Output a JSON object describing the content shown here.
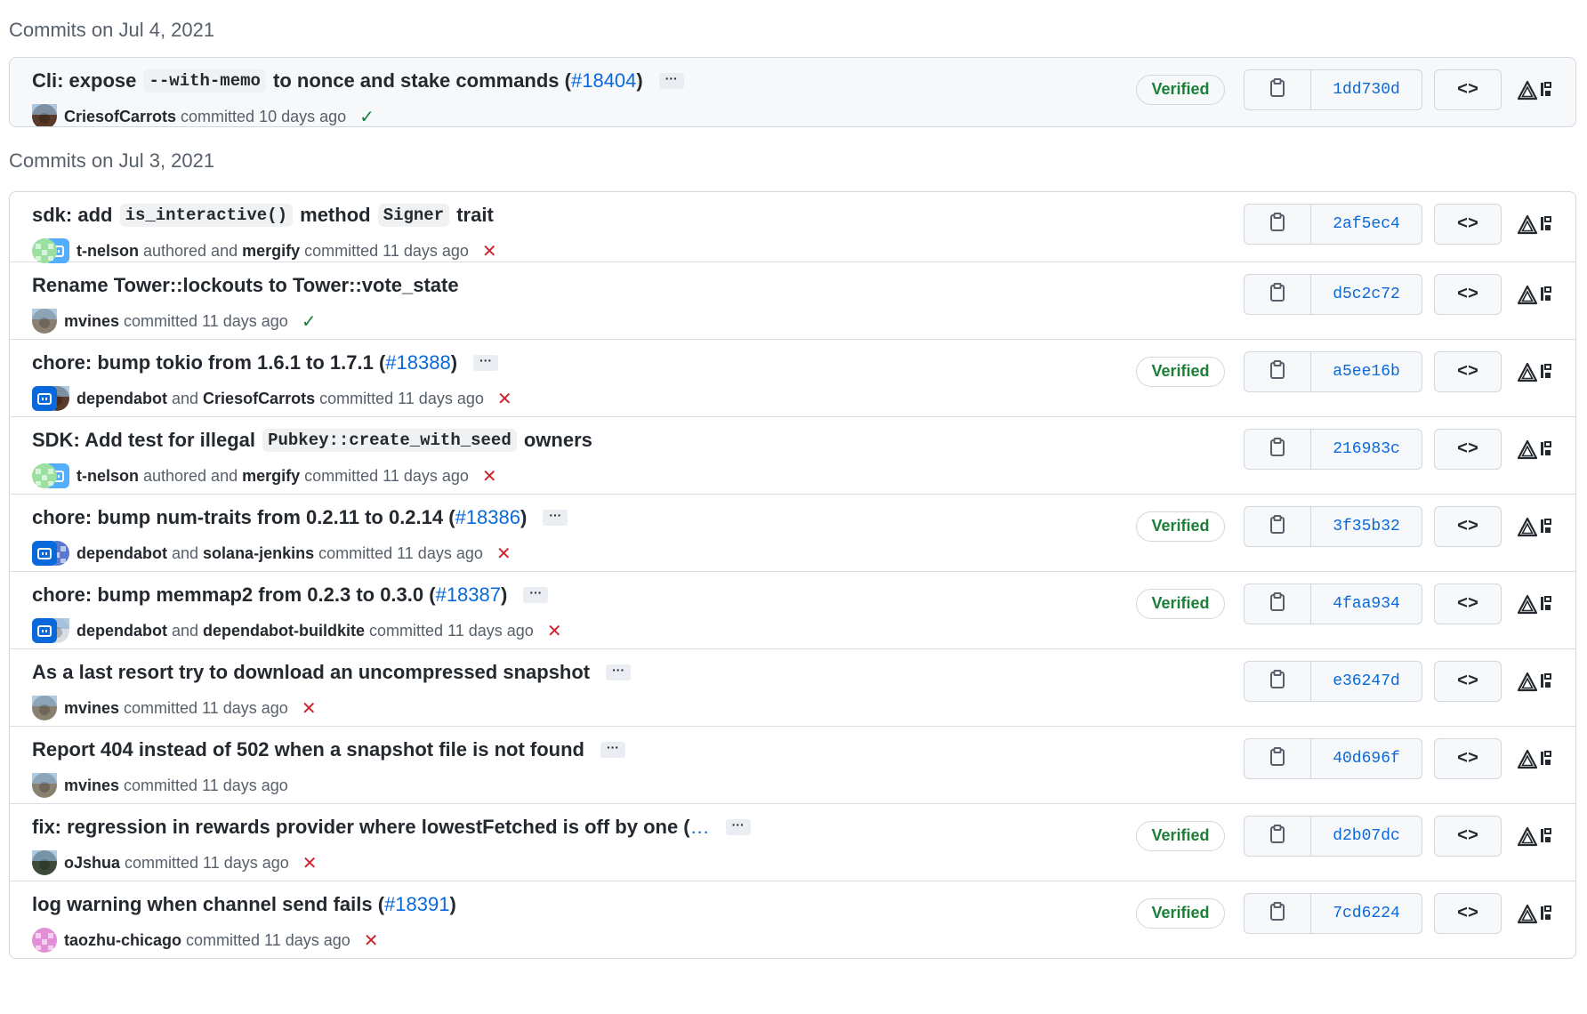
{
  "groups": [
    {
      "heading": "Commits on Jul 4, 2021",
      "highlight": true,
      "commits": [
        {
          "title_parts": [
            {
              "t": "text",
              "v": "Cli: expose "
            },
            {
              "t": "code",
              "v": "--with-memo"
            },
            {
              "t": "text",
              "v": " to nonce and stake commands ("
            },
            {
              "t": "link",
              "v": "#18404"
            },
            {
              "t": "text",
              "v": ")"
            }
          ],
          "has_ellipsis": true,
          "avatars": [
            {
              "kind": "photo",
              "color": "#5a3a2a",
              "name": "criesofcarrots-avatar"
            }
          ],
          "meta_parts": [
            {
              "t": "user",
              "v": "CriesofCarrots"
            },
            {
              "t": "word",
              "v": "committed 10 days ago"
            }
          ],
          "status": "ok",
          "status_glyph": "✓",
          "verified": "Verified",
          "sha": "1dd730d",
          "browse": "<>"
        }
      ]
    },
    {
      "heading": "Commits on Jul 3, 2021",
      "highlight": false,
      "commits": [
        {
          "title_parts": [
            {
              "t": "text",
              "v": "sdk: add "
            },
            {
              "t": "code",
              "v": "is_interactive()"
            },
            {
              "t": "text",
              "v": " method "
            },
            {
              "t": "code",
              "v": "Signer"
            },
            {
              "t": "text",
              "v": " trait"
            }
          ],
          "has_ellipsis": false,
          "avatars": [
            {
              "kind": "pixel",
              "color": "#9be0a0",
              "name": "t-nelson-avatar"
            },
            {
              "kind": "bot",
              "color": "#54aeff",
              "name": "mergify-avatar"
            }
          ],
          "meta_parts": [
            {
              "t": "user",
              "v": "t-nelson"
            },
            {
              "t": "word",
              "v": "authored and"
            },
            {
              "t": "user",
              "v": "mergify"
            },
            {
              "t": "word",
              "v": "committed 11 days ago"
            }
          ],
          "status": "fail",
          "status_glyph": "✕",
          "verified": "",
          "sha": "2af5ec4",
          "browse": "<>"
        },
        {
          "title_parts": [
            {
              "t": "text",
              "v": "Rename Tower::lockouts to Tower::vote_state"
            }
          ],
          "has_ellipsis": false,
          "avatars": [
            {
              "kind": "photo",
              "color": "#8a8070",
              "name": "mvines-avatar"
            }
          ],
          "meta_parts": [
            {
              "t": "user",
              "v": "mvines"
            },
            {
              "t": "word",
              "v": "committed 11 days ago"
            }
          ],
          "status": "ok",
          "status_glyph": "✓",
          "verified": "",
          "sha": "d5c2c72",
          "browse": "<>"
        },
        {
          "title_parts": [
            {
              "t": "text",
              "v": "chore: bump tokio from 1.6.1 to 1.7.1 ("
            },
            {
              "t": "link",
              "v": "#18388"
            },
            {
              "t": "text",
              "v": ")"
            }
          ],
          "has_ellipsis": true,
          "avatars": [
            {
              "kind": "bot",
              "color": "#0969da",
              "name": "dependabot-avatar"
            },
            {
              "kind": "photo",
              "color": "#5a3a2a",
              "name": "criesofcarrots-avatar"
            }
          ],
          "meta_parts": [
            {
              "t": "user",
              "v": "dependabot"
            },
            {
              "t": "word",
              "v": "and"
            },
            {
              "t": "user",
              "v": "CriesofCarrots"
            },
            {
              "t": "word",
              "v": "committed 11 days ago"
            }
          ],
          "status": "fail",
          "status_glyph": "✕",
          "verified": "Verified",
          "sha": "a5ee16b",
          "browse": "<>"
        },
        {
          "title_parts": [
            {
              "t": "text",
              "v": "SDK: Add test for illegal "
            },
            {
              "t": "code",
              "v": "Pubkey::create_with_seed"
            },
            {
              "t": "text",
              "v": " owners"
            }
          ],
          "has_ellipsis": false,
          "avatars": [
            {
              "kind": "pixel",
              "color": "#9be0a0",
              "name": "t-nelson-avatar"
            },
            {
              "kind": "bot",
              "color": "#54aeff",
              "name": "mergify-avatar"
            }
          ],
          "meta_parts": [
            {
              "t": "user",
              "v": "t-nelson"
            },
            {
              "t": "word",
              "v": "authored and"
            },
            {
              "t": "user",
              "v": "mergify"
            },
            {
              "t": "word",
              "v": "committed 11 days ago"
            }
          ],
          "status": "fail",
          "status_glyph": "✕",
          "verified": "",
          "sha": "216983c",
          "browse": "<>"
        },
        {
          "title_parts": [
            {
              "t": "text",
              "v": "chore: bump num-traits from 0.2.11 to 0.2.14 ("
            },
            {
              "t": "link",
              "v": "#18386"
            },
            {
              "t": "text",
              "v": ")"
            }
          ],
          "has_ellipsis": true,
          "avatars": [
            {
              "kind": "bot",
              "color": "#0969da",
              "name": "dependabot-avatar"
            },
            {
              "kind": "pixel",
              "color": "#5a78d0",
              "name": "solana-jenkins-avatar"
            }
          ],
          "meta_parts": [
            {
              "t": "user",
              "v": "dependabot"
            },
            {
              "t": "word",
              "v": "and"
            },
            {
              "t": "user",
              "v": "solana-jenkins"
            },
            {
              "t": "word",
              "v": "committed 11 days ago"
            }
          ],
          "status": "fail",
          "status_glyph": "✕",
          "verified": "Verified",
          "sha": "3f35b32",
          "browse": "<>"
        },
        {
          "title_parts": [
            {
              "t": "text",
              "v": "chore: bump memmap2 from 0.2.3 to 0.3.0 ("
            },
            {
              "t": "link",
              "v": "#18387"
            },
            {
              "t": "text",
              "v": ")"
            }
          ],
          "has_ellipsis": true,
          "avatars": [
            {
              "kind": "bot",
              "color": "#0969da",
              "name": "dependabot-avatar"
            },
            {
              "kind": "photo",
              "color": "#d8dde3",
              "name": "dependabot-buildkite-avatar"
            }
          ],
          "meta_parts": [
            {
              "t": "user",
              "v": "dependabot"
            },
            {
              "t": "word",
              "v": "and"
            },
            {
              "t": "user",
              "v": "dependabot-buildkite"
            },
            {
              "t": "word",
              "v": "committed 11 days ago"
            }
          ],
          "status": "fail",
          "status_glyph": "✕",
          "verified": "Verified",
          "sha": "4faa934",
          "browse": "<>"
        },
        {
          "title_parts": [
            {
              "t": "text",
              "v": "As a last resort try to download an uncompressed snapshot"
            }
          ],
          "has_ellipsis": true,
          "avatars": [
            {
              "kind": "photo",
              "color": "#8a8070",
              "name": "mvines-avatar"
            }
          ],
          "meta_parts": [
            {
              "t": "user",
              "v": "mvines"
            },
            {
              "t": "word",
              "v": "committed 11 days ago"
            }
          ],
          "status": "fail",
          "status_glyph": "✕",
          "verified": "",
          "sha": "e36247d",
          "browse": "<>"
        },
        {
          "title_parts": [
            {
              "t": "text",
              "v": "Report 404 instead of 502 when a snapshot file is not found"
            }
          ],
          "has_ellipsis": true,
          "avatars": [
            {
              "kind": "photo",
              "color": "#8a8070",
              "name": "mvines-avatar"
            }
          ],
          "meta_parts": [
            {
              "t": "user",
              "v": "mvines"
            },
            {
              "t": "word",
              "v": "committed 11 days ago"
            }
          ],
          "status": "none",
          "status_glyph": "",
          "verified": "",
          "sha": "40d696f",
          "browse": "<>"
        },
        {
          "title_parts": [
            {
              "t": "text",
              "v": "fix: regression in rewards provider where lowestFetched is off by one ("
            },
            {
              "t": "link",
              "v": "…"
            }
          ],
          "has_ellipsis": true,
          "avatars": [
            {
              "kind": "photo",
              "color": "#3d4a3a",
              "name": "ojshua-avatar"
            }
          ],
          "meta_parts": [
            {
              "t": "user",
              "v": "oJshua"
            },
            {
              "t": "word",
              "v": "committed 11 days ago"
            }
          ],
          "status": "fail",
          "status_glyph": "✕",
          "verified": "Verified",
          "sha": "d2b07dc",
          "browse": "<>"
        },
        {
          "title_parts": [
            {
              "t": "text",
              "v": "log warning when channel send fails ("
            },
            {
              "t": "link",
              "v": "#18391"
            },
            {
              "t": "text",
              "v": ")"
            }
          ],
          "has_ellipsis": false,
          "avatars": [
            {
              "kind": "pixel",
              "color": "#e38fd8",
              "name": "taozhu-chicago-avatar"
            }
          ],
          "meta_parts": [
            {
              "t": "user",
              "v": "taozhu-chicago"
            },
            {
              "t": "word",
              "v": "committed 11 days ago"
            }
          ],
          "status": "fail",
          "status_glyph": "✕",
          "verified": "Verified",
          "sha": "7cd6224",
          "browse": "<>"
        }
      ]
    }
  ],
  "ellipsis_label": "···",
  "colors": {
    "link": "#0969da",
    "verified": "#1a7f37",
    "ok": "#1a7f37",
    "fail": "#cf222e",
    "border": "#d0d7de"
  },
  "icons": {
    "copy": "clipboard-icon",
    "ext": "triangle-extension-icon"
  }
}
